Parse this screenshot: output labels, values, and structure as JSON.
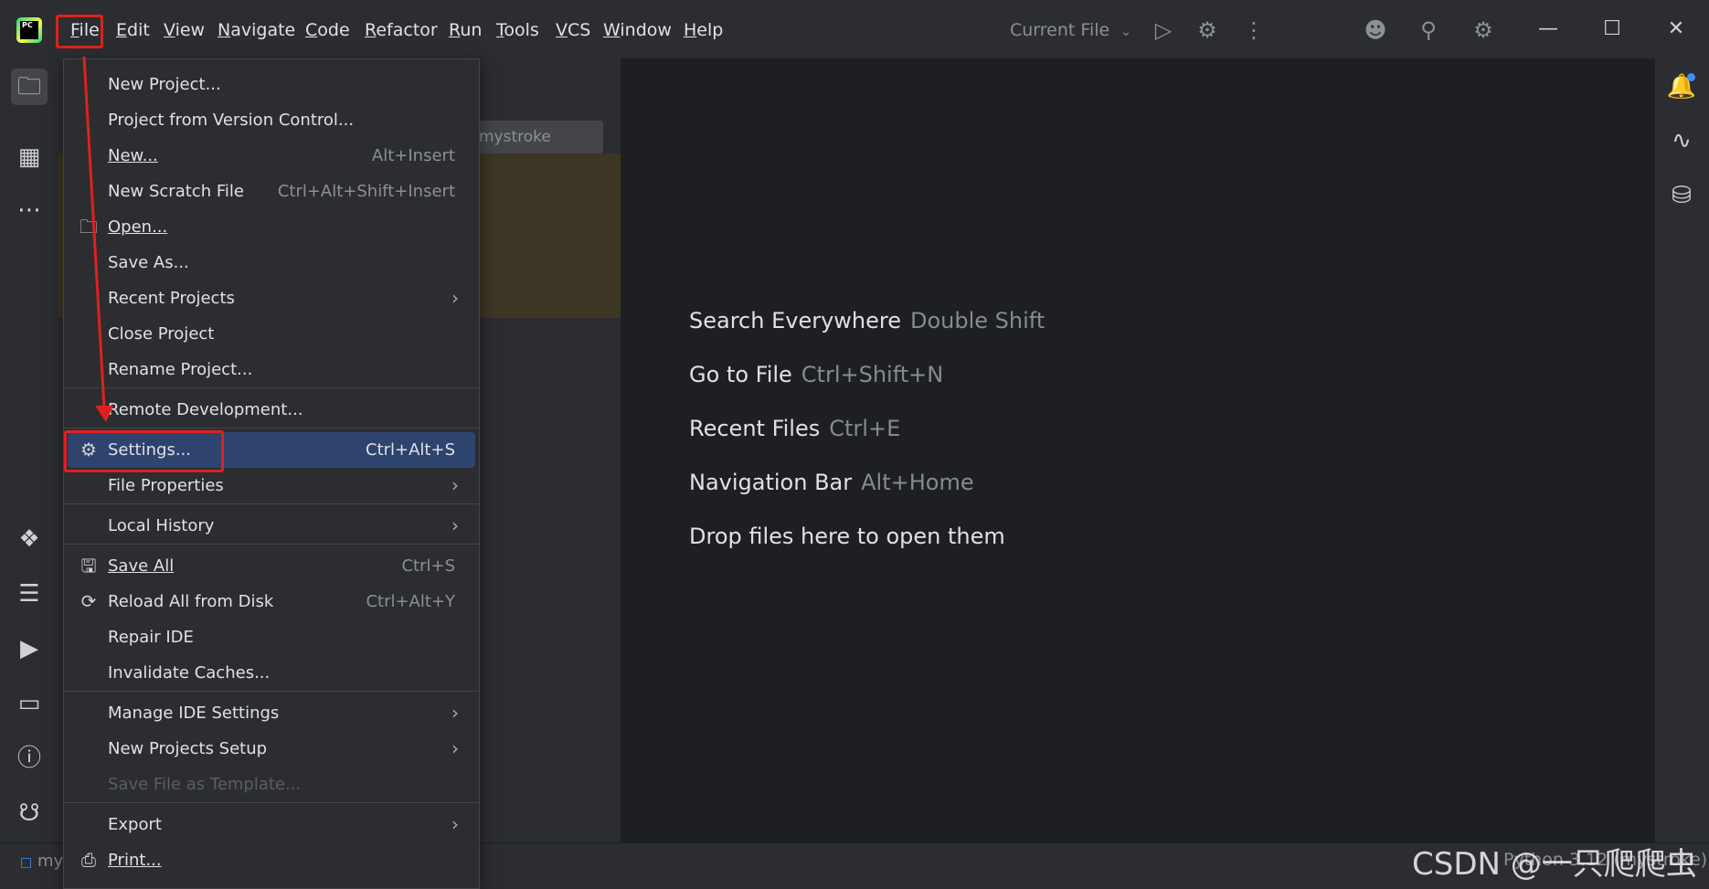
{
  "titlebar": {
    "menu": [
      {
        "label": "File",
        "underline": "F",
        "rest": "ile"
      },
      {
        "label": "Edit",
        "underline": "E",
        "rest": "dit"
      },
      {
        "label": "View",
        "underline": "V",
        "rest": "iew"
      },
      {
        "label": "Navigate",
        "underline": "N",
        "rest": "avigate"
      },
      {
        "label": "Code",
        "underline": "C",
        "rest": "ode"
      },
      {
        "label": "Refactor",
        "underline": "R",
        "rest": "efactor"
      },
      {
        "label": "Run",
        "underline": "R",
        "rest": "un"
      },
      {
        "label": "Tools",
        "underline": "T",
        "rest": "ools"
      },
      {
        "label": "VCS",
        "underline": "V",
        "rest": "CS"
      },
      {
        "label": "Window",
        "underline": "W",
        "rest": "indow"
      },
      {
        "label": "Help",
        "underline": "H",
        "rest": "elp"
      }
    ],
    "run_config": "Current File",
    "logo_text": "PC"
  },
  "project_panel": {
    "tree_chip": "mystroke"
  },
  "file_menu": {
    "items": [
      {
        "label": "New Project...",
        "shortcut": "",
        "submenu": false,
        "icon": ""
      },
      {
        "label": "Project from Version Control...",
        "shortcut": "",
        "submenu": false,
        "icon": ""
      },
      {
        "label": "New...",
        "shortcut": "Alt+Insert",
        "submenu": false,
        "icon": ""
      },
      {
        "label": "New Scratch File",
        "shortcut": "Ctrl+Alt+Shift+Insert",
        "submenu": false,
        "icon": ""
      },
      {
        "label": "Open...",
        "shortcut": "",
        "submenu": false,
        "icon": "folder-icon"
      },
      {
        "label": "Save As...",
        "shortcut": "",
        "submenu": false,
        "icon": ""
      },
      {
        "label": "Recent Projects",
        "shortcut": "",
        "submenu": true,
        "icon": ""
      },
      {
        "label": "Close Project",
        "shortcut": "",
        "submenu": false,
        "icon": ""
      },
      {
        "label": "Rename Project...",
        "shortcut": "",
        "submenu": false,
        "icon": ""
      },
      {
        "label": "Remote Development...",
        "shortcut": "",
        "submenu": false,
        "icon": ""
      },
      {
        "label": "Settings...",
        "shortcut": "Ctrl+Alt+S",
        "submenu": false,
        "icon": "gear-icon",
        "selected": true
      },
      {
        "label": "File Properties",
        "shortcut": "",
        "submenu": true,
        "icon": ""
      },
      {
        "label": "Local History",
        "shortcut": "",
        "submenu": true,
        "icon": ""
      },
      {
        "label": "Save All",
        "shortcut": "Ctrl+S",
        "submenu": false,
        "icon": "save-icon"
      },
      {
        "label": "Reload All from Disk",
        "shortcut": "Ctrl+Alt+Y",
        "submenu": false,
        "icon": "reload-icon"
      },
      {
        "label": "Repair IDE",
        "shortcut": "",
        "submenu": false,
        "icon": ""
      },
      {
        "label": "Invalidate Caches...",
        "shortcut": "",
        "submenu": false,
        "icon": ""
      },
      {
        "label": "Manage IDE Settings",
        "shortcut": "",
        "submenu": true,
        "icon": ""
      },
      {
        "label": "New Projects Setup",
        "shortcut": "",
        "submenu": true,
        "icon": ""
      },
      {
        "label": "Save File as Template...",
        "shortcut": "",
        "submenu": false,
        "icon": "",
        "disabled": true
      },
      {
        "label": "Export",
        "shortcut": "",
        "submenu": true,
        "icon": ""
      },
      {
        "label": "Print...",
        "shortcut": "",
        "submenu": false,
        "icon": "print-icon"
      }
    ]
  },
  "editor": {
    "hints": [
      {
        "label": "Search Everywhere",
        "key": "Double Shift"
      },
      {
        "label": "Go to File",
        "key": "Ctrl+Shift+N"
      },
      {
        "label": "Recent Files",
        "key": "Ctrl+E"
      },
      {
        "label": "Navigation Bar",
        "key": "Alt+Home"
      },
      {
        "label": "Drop files here to open them",
        "key": ""
      }
    ]
  },
  "statusbar": {
    "left": "my",
    "right": "Python 3.12 (mystroke)"
  },
  "watermark": "CSDN @一只爬爬虫",
  "colors": {
    "accent_selection": "#2e436e",
    "annotation_red": "#e02020",
    "background": "#2b2d30",
    "editor_bg": "#1e1f22"
  }
}
